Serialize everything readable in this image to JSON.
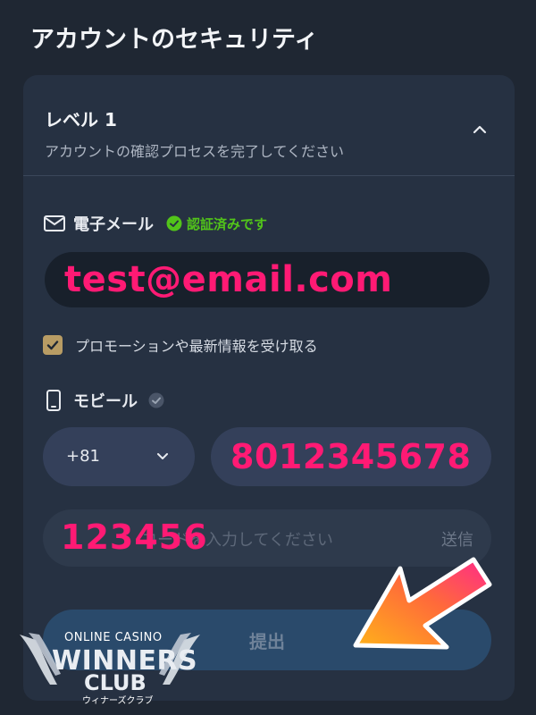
{
  "page": {
    "title": "アカウントのセキュリティ"
  },
  "level": {
    "title": "レベル 1",
    "subtitle": "アカウントの確認プロセスを完了してください"
  },
  "email": {
    "label": "電子メール",
    "status": "認証済みです",
    "value": "test@email.com"
  },
  "promo": {
    "label": "プロモーションや最新情報を受け取る",
    "checked": true
  },
  "mobile": {
    "label": "モビール",
    "country_code": "+81",
    "phone_value": "8012345678",
    "code_placeholder": "コードを入力してください",
    "code_value": "123456",
    "send_label": "送信"
  },
  "submit": {
    "label": "提出"
  },
  "logo": {
    "top_text": "ONLINE CASINO",
    "main_text": "WINNERS",
    "club_text": "CLUB",
    "sub_text": "ウィナーズクラブ"
  },
  "colors": {
    "background": "#1f2733",
    "card": "#263142",
    "accent_pink": "#ff1a74",
    "verified_green": "#52c41a",
    "checkbox_gold": "#b89c64",
    "submit_blue": "#2a4a6b"
  }
}
